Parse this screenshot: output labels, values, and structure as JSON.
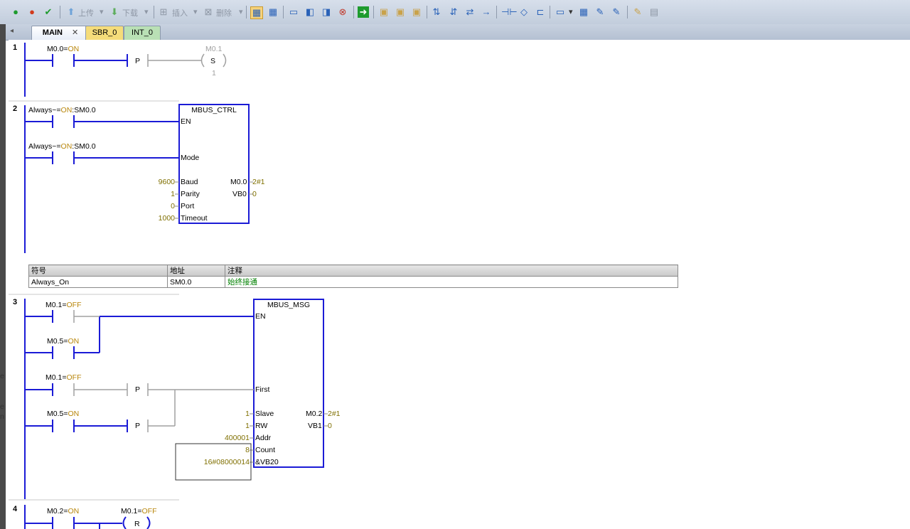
{
  "toolbar": {
    "upload_label": "上传",
    "download_label": "下载",
    "insert_label": "插入",
    "delete_label": "删除"
  },
  "tabs": [
    {
      "label": "MAIN",
      "close": "✕"
    },
    {
      "label": "SBR_0"
    },
    {
      "label": "INT_0"
    }
  ],
  "networks": [
    {
      "number": "1",
      "contact1": {
        "name": "M0.0",
        "eq": "=",
        "state": "ON"
      },
      "p_label": "P",
      "coil": {
        "addr": "M0.1",
        "type": "S",
        "count": "1"
      }
    },
    {
      "number": "2",
      "contact_en": {
        "name": "Always~",
        "eq": "=",
        "state": "ON",
        "addr": ":SM0.0"
      },
      "contact_mode": {
        "name": "Always~",
        "eq": "=",
        "state": "ON",
        "addr": ":SM0.0"
      },
      "box": {
        "title": "MBUS_CTRL",
        "en": "EN",
        "mode": "Mode",
        "baud": "Baud",
        "parity": "Parity",
        "port": "Port",
        "timeout": "Timeout",
        "done": "M0.0",
        "error": "VB0",
        "baud_val": "9600",
        "parity_val": "1",
        "port_val": "0",
        "timeout_val": "1000",
        "done_val": "2#1",
        "error_val": "0"
      },
      "symbol_table": {
        "headers": [
          "符号",
          "地址",
          "注释"
        ],
        "rows": [
          [
            "Always_On",
            "SM0.0",
            "始终接通"
          ]
        ]
      }
    },
    {
      "number": "3",
      "c1": {
        "name": "M0.1",
        "eq": "=",
        "state": "OFF"
      },
      "c2": {
        "name": "M0.5",
        "eq": "=",
        "state": "ON"
      },
      "c3": {
        "name": "M0.1",
        "eq": "=",
        "state": "OFF"
      },
      "c4": {
        "name": "M0.5",
        "eq": "=",
        "state": "ON"
      },
      "p_label": "P",
      "box": {
        "title": "MBUS_MSG",
        "en": "EN",
        "first": "First",
        "slave": "Slave",
        "rw": "RW",
        "addr": "Addr",
        "count": "Count",
        "dataptr": "&VB20",
        "done": "M0.2",
        "error": "VB1",
        "slave_val": "1",
        "rw_val": "1",
        "addr_val": "400001",
        "count_val": "8",
        "ptr_val": "16#08000014",
        "done_val": "2#1",
        "error_val": "0"
      }
    },
    {
      "number": "4",
      "c1": {
        "name": "M0.2",
        "eq": "=",
        "state": "ON"
      },
      "coil": {
        "addr": "M0.1",
        "eq": "=",
        "state": "OFF",
        "type": "R"
      }
    }
  ]
}
